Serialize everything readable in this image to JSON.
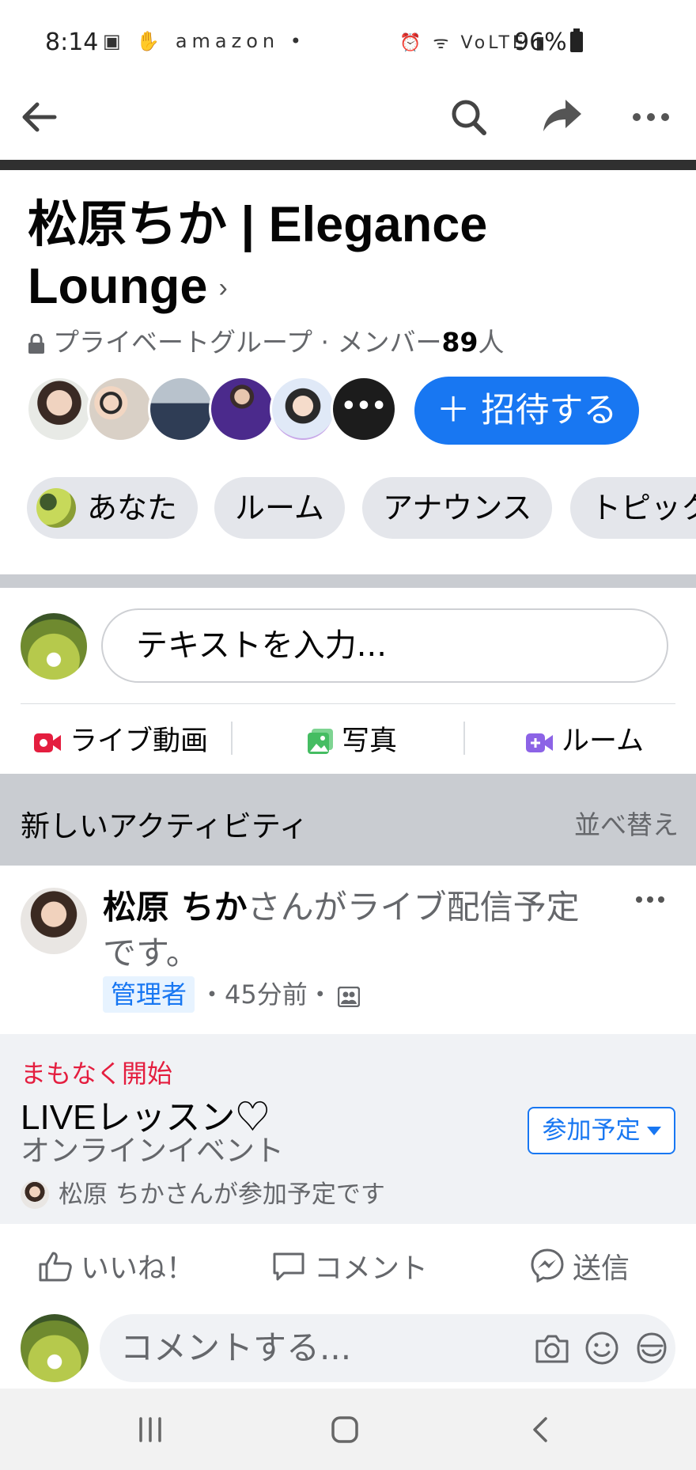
{
  "status_bar": {
    "time": "8:14",
    "battery": "96%",
    "left_icons": "▣ ✋ amazon •",
    "right_icons": "⏰ ᯤ VoLTE ▮"
  },
  "group": {
    "title_line1": "松原ちか | Elegance",
    "title_line2": "Lounge",
    "privacy": "プライベートグループ · メンバー",
    "member_count": "89",
    "member_suffix": "人",
    "invite_label": "＋ 招待する",
    "more_avatars": "•••"
  },
  "chips": [
    {
      "label": "あなた"
    },
    {
      "label": "ルーム"
    },
    {
      "label": "アナウンス"
    },
    {
      "label": "トピック"
    }
  ],
  "composer": {
    "placeholder": "テキストを入力...",
    "live_label": "ライブ動画",
    "photo_label": "写真",
    "room_label": "ルーム"
  },
  "activity": {
    "title": "新しいアクティビティ",
    "sort_label": "並べ替え"
  },
  "post": {
    "author": "松原 ちか",
    "action_text": "さんがライブ配信予定です。",
    "role_badge": "管理者",
    "time": "・45分前・"
  },
  "event": {
    "status": "まもなく開始",
    "title": "LIVEレッスン♡",
    "type": "オンラインイベント",
    "attendee_text": "松原 ちかさんが参加予定です",
    "going_label": "参加予定"
  },
  "reactions": {
    "like": "いいね！",
    "comment": "コメント",
    "send": "送信"
  },
  "comment_box": {
    "placeholder": "コメントする..."
  },
  "colors": {
    "accent": "#1877f2",
    "live_red": "#e41e3f",
    "photo_green": "#45bd62",
    "room_purple": "#8c63e6",
    "divider": "#c9ccd1",
    "secondary_text": "#65676b"
  },
  "icons": {
    "back": "arrow-left-icon",
    "search": "search-icon",
    "share": "share-icon",
    "more": "more-horizontal-icon",
    "lock": "lock-icon",
    "live": "live-video-icon",
    "photo": "photo-icon",
    "room": "room-icon",
    "audience": "group-audience-icon",
    "like": "thumbs-up-icon",
    "comment": "comment-bubble-icon",
    "send": "messenger-icon",
    "camera": "camera-icon",
    "emoji": "emoji-icon",
    "sticker": "sticker-icon"
  }
}
